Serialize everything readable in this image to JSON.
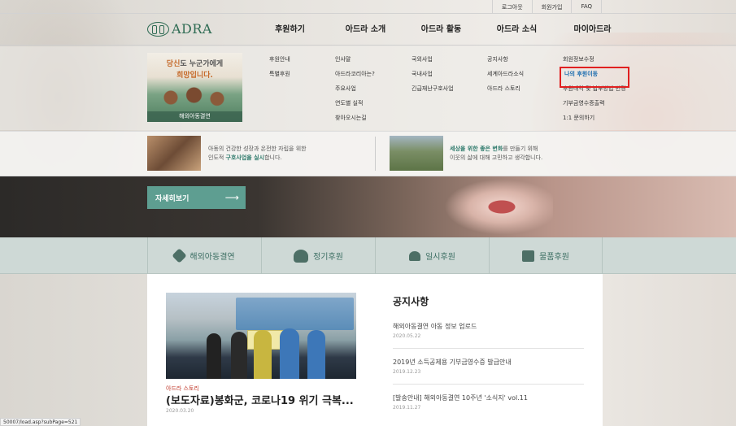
{
  "util_links": [
    "로그아웃",
    "회원가입",
    "FAQ"
  ],
  "logo": {
    "text": "ADRA",
    "icon": "adra-hands-icon"
  },
  "gnb": [
    "후원하기",
    "아드라 소개",
    "아드라 활동",
    "아드라 소식",
    "마이아드라"
  ],
  "promo": {
    "line1_highlight": "당신",
    "line1_rest": "도 누군가에게",
    "line2": "희망입니다.",
    "caption": "해외아동결연"
  },
  "menu": {
    "col1": [
      "후원안내",
      "특별후원"
    ],
    "col2": [
      "인사말",
      "아드라코리아는?",
      "주요사업",
      "연도별 실적",
      "찾아오시는길"
    ],
    "col3": [
      "국외사업",
      "국내사업",
      "긴급재난구호사업"
    ],
    "col4": [
      "공지사항",
      "세계아드라소식",
      "아드라 스토리"
    ],
    "col5": [
      "회원정보수정",
      "나의 후원이동",
      "후원내역 및 납부방법 변경",
      "기부금영수증출력",
      "1:1 문의하기"
    ],
    "highlighted": "나의 후원이동"
  },
  "strip": {
    "left_a": "아동의 건강한 성장과 온전한 자립을 위한",
    "left_b_pre": "인도적 ",
    "left_b_bold": "구호사업을 실시",
    "left_b_post": "합니다.",
    "right_a_bold": "세상을 위한 좋은 변화",
    "right_a_post": "를 만들기 위해",
    "right_b": "이웃의 삶에 대해 고민하고 생각합니다."
  },
  "hero": {
    "button": "자세히보기",
    "arrow": "⟶"
  },
  "tabs": [
    {
      "label": "해외아동결연",
      "icon": "handshake-icon"
    },
    {
      "label": "정기후원",
      "icon": "heart-hands-icon"
    },
    {
      "label": "일시후원",
      "icon": "sprout-icon"
    },
    {
      "label": "물품후원",
      "icon": "gift-icon"
    }
  ],
  "news": {
    "category": "아드라 스토리",
    "title": "(보도자료)봉화군, 코로나19 위기 극복...",
    "date": "2020.03.20"
  },
  "notice": {
    "heading": "공지사항",
    "items": [
      {
        "title": "해외아동결연 아동 정보 업로드",
        "date": "2020.05.22"
      },
      {
        "title": "2019년 소득공제용 기부금영수증 발급안내",
        "date": "2019.12.23"
      },
      {
        "title": "[발송안내] 해외아동결연 10주년 '소식지' vol.11",
        "date": "2019.11.27"
      }
    ]
  },
  "status_bar": "50007/load.asp?subPage=521"
}
